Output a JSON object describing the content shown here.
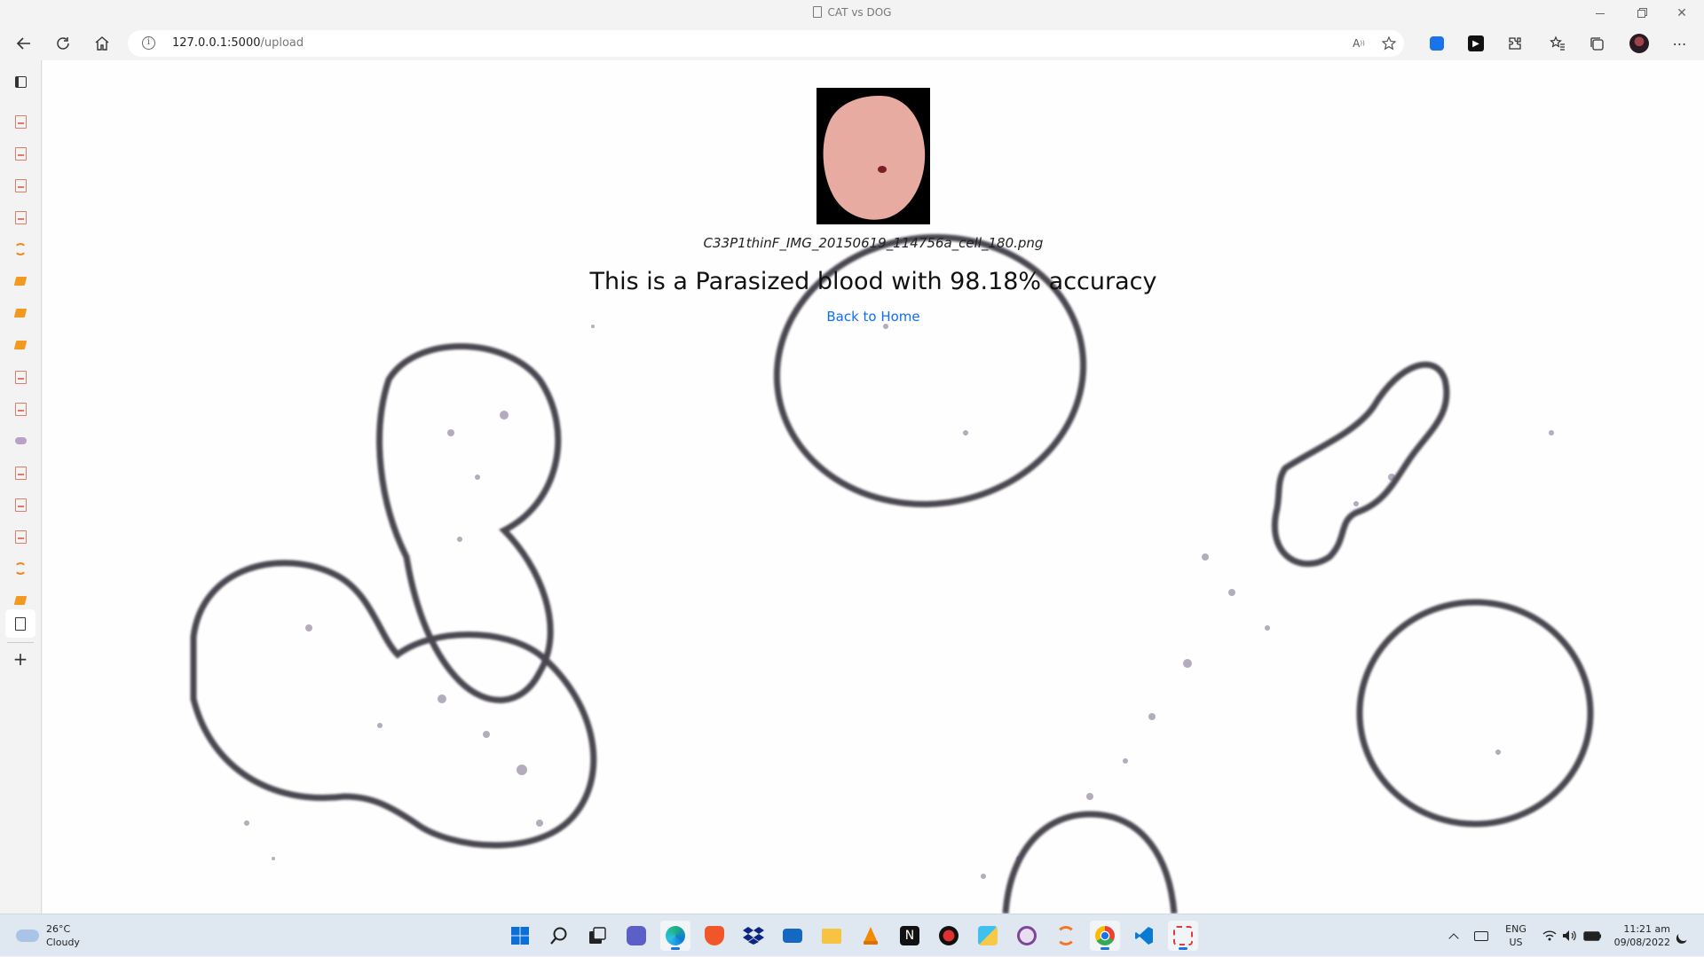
{
  "window": {
    "title": "CAT vs DOG",
    "controls": [
      "minimize-icon",
      "restore-icon",
      "close-icon"
    ]
  },
  "toolbar": {
    "url_host": "127.0.0.1:5000",
    "url_path": "/upload",
    "read_aloud_label": "A",
    "icons": [
      "back-icon",
      "refresh-icon",
      "home-icon",
      "info-icon",
      "read-aloud-icon",
      "favorite-add-icon",
      "extension-icon",
      "media-icon",
      "extensions-icon",
      "favorites-icon",
      "collections-icon",
      "profile-avatar",
      "more-icon"
    ]
  },
  "sidebar": {
    "tabs": [
      "workspace-icon",
      "pdf-icon",
      "pdf-icon",
      "pdf-icon",
      "pdf-icon",
      "loading-icon",
      "book-icon",
      "book-icon",
      "book-icon",
      "pdf-icon",
      "pdf-icon",
      "pill-icon",
      "pdf-icon",
      "pdf-icon",
      "pdf-icon",
      "loading-icon",
      "book-icon",
      "page-icon"
    ],
    "add_label": "+"
  },
  "page": {
    "filename": "C33P1thinF_IMG_20150619_114756a_cell_180.png",
    "result_text": "This is a Parasized blood with 98.18% accuracy",
    "back_link": "Back to Home",
    "link_color": "#0d6efd"
  },
  "taskbar": {
    "weather": {
      "temp": "26°C",
      "condition": "Cloudy"
    },
    "apps": [
      "start-icon",
      "search-icon",
      "task-view-icon",
      "teams-chat-icon",
      "edge-icon",
      "brave-icon",
      "dropbox-icon",
      "mail-icon",
      "file-explorer-icon",
      "vlc-icon",
      "notion-icon",
      "app-red-icon",
      "app-puzzle-icon",
      "tor-icon",
      "jupyter-icon",
      "chrome-icon",
      "vscode-icon",
      "snipping-tool-icon"
    ],
    "tray": {
      "lang_top": "ENG",
      "lang_bottom": "US",
      "time": "11:21 am",
      "date": "09/08/2022"
    }
  }
}
